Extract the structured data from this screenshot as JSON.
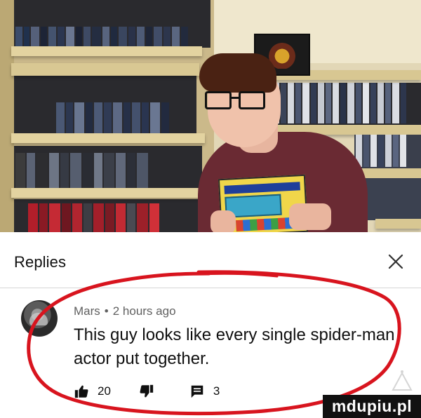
{
  "replies_panel": {
    "title": "Replies",
    "close_icon": "close-icon"
  },
  "comment": {
    "author": "Mars",
    "separator": "•",
    "time": "2 hours ago",
    "text": "This guy looks like every single spider-man actor put together.",
    "likes": "20",
    "reply_count": "3",
    "icons": {
      "like": "thumbs-up-icon",
      "dislike": "thumbs-down-icon",
      "reply": "comment-icon"
    }
  },
  "annotation": {
    "loop_color": "#d8141e"
  },
  "watermark": {
    "text": "mdupiu.pl"
  }
}
